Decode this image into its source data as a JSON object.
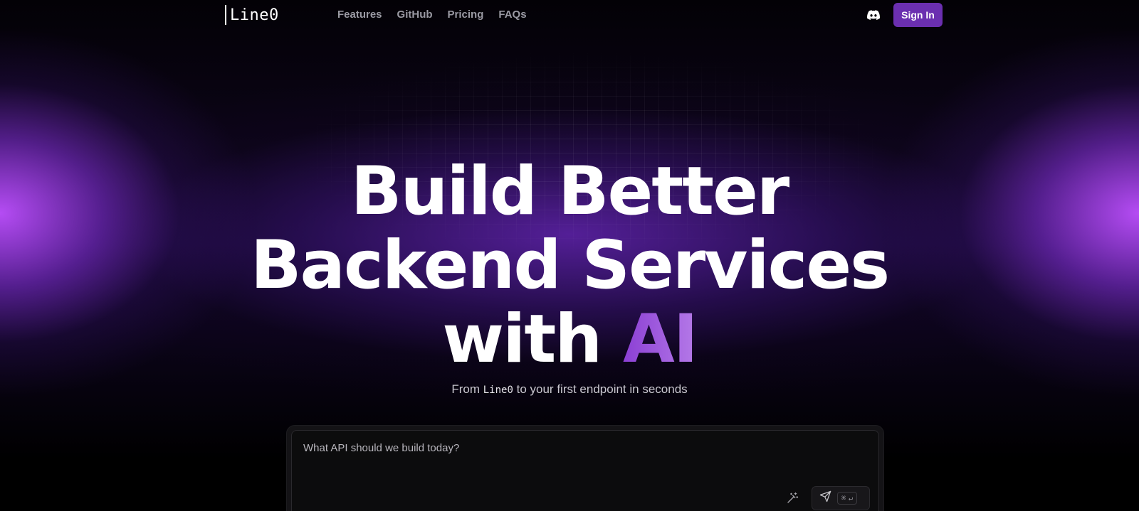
{
  "nav": {
    "logo": "Line0",
    "links": [
      "Features",
      "GitHub",
      "Pricing",
      "FAQs"
    ],
    "discord_icon": "discord-icon",
    "signin_label": "Sign In"
  },
  "hero": {
    "line1": "Build Better",
    "line2": "Backend Services",
    "line3_prefix": "with",
    "line3_accent": "AI",
    "subtitle_prefix": "From",
    "subtitle_code": "Line0",
    "subtitle_suffix": "to your first endpoint in seconds"
  },
  "prompt": {
    "placeholder": "What API should we build today?",
    "enhance_icon": "magic-wand-icon",
    "send_icon": "send-icon",
    "shortcut_cmd": "⌘",
    "shortcut_enter": "↵"
  },
  "colors": {
    "accent": "#6b2fb0",
    "glow": "#b050ff"
  }
}
